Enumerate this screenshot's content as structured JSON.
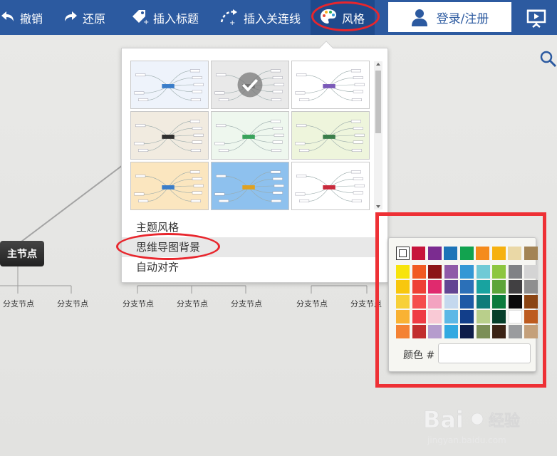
{
  "toolbar": {
    "undo": "撤销",
    "redo": "还原",
    "insert_title": "插入标题",
    "insert_link": "插入关连线",
    "style": "风格",
    "login": "登录/注册"
  },
  "canvas": {
    "main_node": "主节点",
    "branch_labels": [
      "分支节点",
      "分支节点",
      "分支节点",
      "分支节点",
      "分支节点",
      "分支节点",
      "分支节点"
    ]
  },
  "style_panel": {
    "menu": {
      "theme_style": "主题风格",
      "mindmap_background": "思维导图背景",
      "auto_align": "自动对齐"
    }
  },
  "color_picker": {
    "label": "颜色 #",
    "input_value": "",
    "top_row": [
      "#c7143b",
      "#7b2c90",
      "#1c74b8",
      "#12a34f",
      "#f58b1c",
      "#f6b10f",
      "#ead8a6",
      "#a38455"
    ],
    "grid": [
      [
        "#f7e40c",
        "#f15a22",
        "#8c1516",
        "#8f5aa8",
        "#3397d5",
        "#6fcad6",
        "#8dc63f",
        "#808285",
        "#d4d4d4"
      ],
      [
        "#f8c70e",
        "#ee4035",
        "#e02a6e",
        "#634593",
        "#2b70b8",
        "#18a3a0",
        "#5da539",
        "#414042",
        "#8f8f8f"
      ],
      [
        "#f7d038",
        "#f54d4d",
        "#f3a3c0",
        "#c4d8ee",
        "#1d5aa6",
        "#0f7b79",
        "#0b7b3c",
        "#0a0a0a",
        "#8b4513"
      ],
      [
        "#f9b233",
        "#ef3b44",
        "#f9c9d5",
        "#5cb8e6",
        "#123e8a",
        "#b9cf8b",
        "#073f2a",
        "#ffffff",
        "#bd5b1f"
      ],
      [
        "#f48233",
        "#c12d2d",
        "#b59ccd",
        "#31a9e1",
        "#0e1d4a",
        "#7c8f57",
        "#3b2314",
        "#9a9c9e",
        "#c4a07a"
      ]
    ]
  }
}
